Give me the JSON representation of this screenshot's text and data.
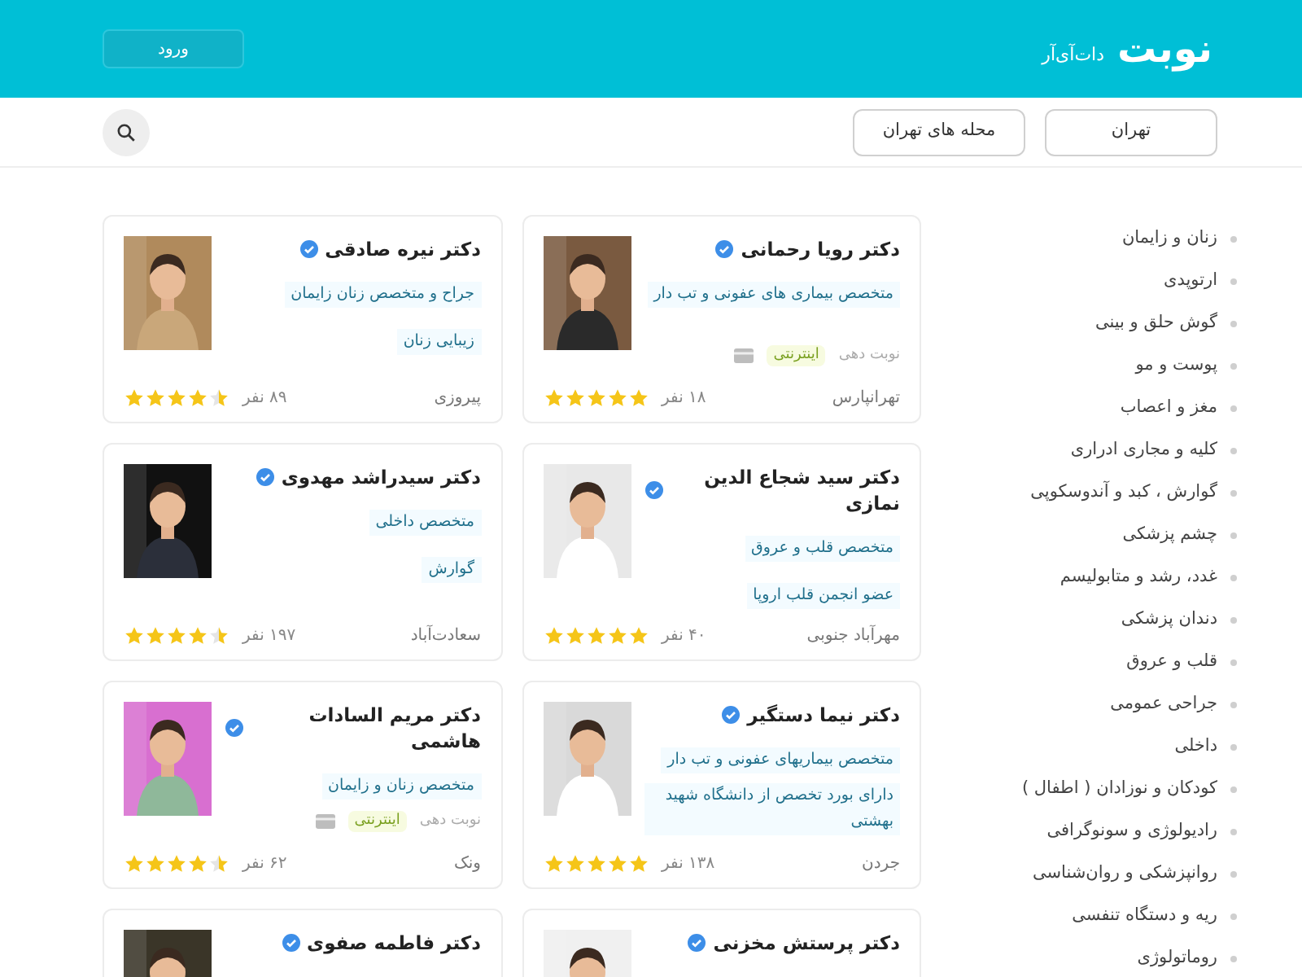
{
  "header": {
    "logo": "نوبت",
    "logo_suffix": "دات‌آی‌آر",
    "login_button": "ورود"
  },
  "filters": [
    {
      "label": "تهران"
    },
    {
      "label": "محله های تهران"
    }
  ],
  "sidebar": {
    "items": [
      "زنان و زایمان",
      "ارتوپدی",
      "گوش حلق و بینی",
      "پوست و مو",
      "مغز و اعصاب",
      "کلیه و مجاری ادراری",
      "گوارش ، کبد و آندوسکوپی",
      "چشم پزشکی",
      "غدد، رشد و متابولیسم",
      "دندان پزشکی",
      "قلب و عروق",
      "جراحی عمومی",
      "داخلی",
      "کودکان و نوزادان ( اطفال )",
      "رادیولوژی و سونوگرافی",
      "روانپزشکی و روان‌شناسی",
      "ریه و دستگاه تنفسی",
      "روماتولوژی"
    ]
  },
  "doctors": [
    {
      "name": "دکتر رویا رحمانی",
      "verified": true,
      "specialties": [
        "متخصص بیماری های عفونی و تب دار"
      ],
      "booking": {
        "label": "نوبت دهی",
        "badge": "اینترنتی"
      },
      "area": "تهرانپارس",
      "reviews": "۱۸ نفر",
      "stars": 5
    },
    {
      "name": "دکتر نیره صادقی",
      "verified": true,
      "specialties": [
        "جراح و متخصص زنان زایمان",
        "زیبایی زنان"
      ],
      "area": "پیروزی",
      "reviews": "۸۹ نفر",
      "stars": 4.5
    },
    {
      "name": "دکتر سید شجاع الدین نمازی",
      "verified": true,
      "specialties": [
        "متخصص قلب و عروق",
        "عضو انجمن قلب اروپا"
      ],
      "area": "مهرآباد جنوبی",
      "reviews": "۴۰ نفر",
      "stars": 5
    },
    {
      "name": "دکتر سیدراشد مهدوی",
      "verified": true,
      "specialties": [
        "متخصص داخلی",
        "گوارش"
      ],
      "area": "سعادت‌آباد",
      "reviews": "۱۹۷ نفر",
      "stars": 4.5
    },
    {
      "name": "دکتر نیما دستگیر",
      "verified": true,
      "specialties": [
        "متخصص بیماریهای عفونی و تب دار",
        "دارای بورد تخصص از دانشگاه شهید بهشتی"
      ],
      "area": "جردن",
      "reviews": "۱۳۸ نفر",
      "stars": 5
    },
    {
      "name": "دکتر مریم السادات هاشمی",
      "verified": true,
      "specialties": [
        "متخصص زنان و زایمان"
      ],
      "booking": {
        "label": "نوبت دهی",
        "badge": "اینترنتی"
      },
      "area": "ونک",
      "reviews": "۶۲ نفر",
      "stars": 4.5
    },
    {
      "name": "دکتر پرستش مخزنی",
      "verified": true
    },
    {
      "name": "دکتر فاطمه صفوی",
      "verified": true
    }
  ]
}
